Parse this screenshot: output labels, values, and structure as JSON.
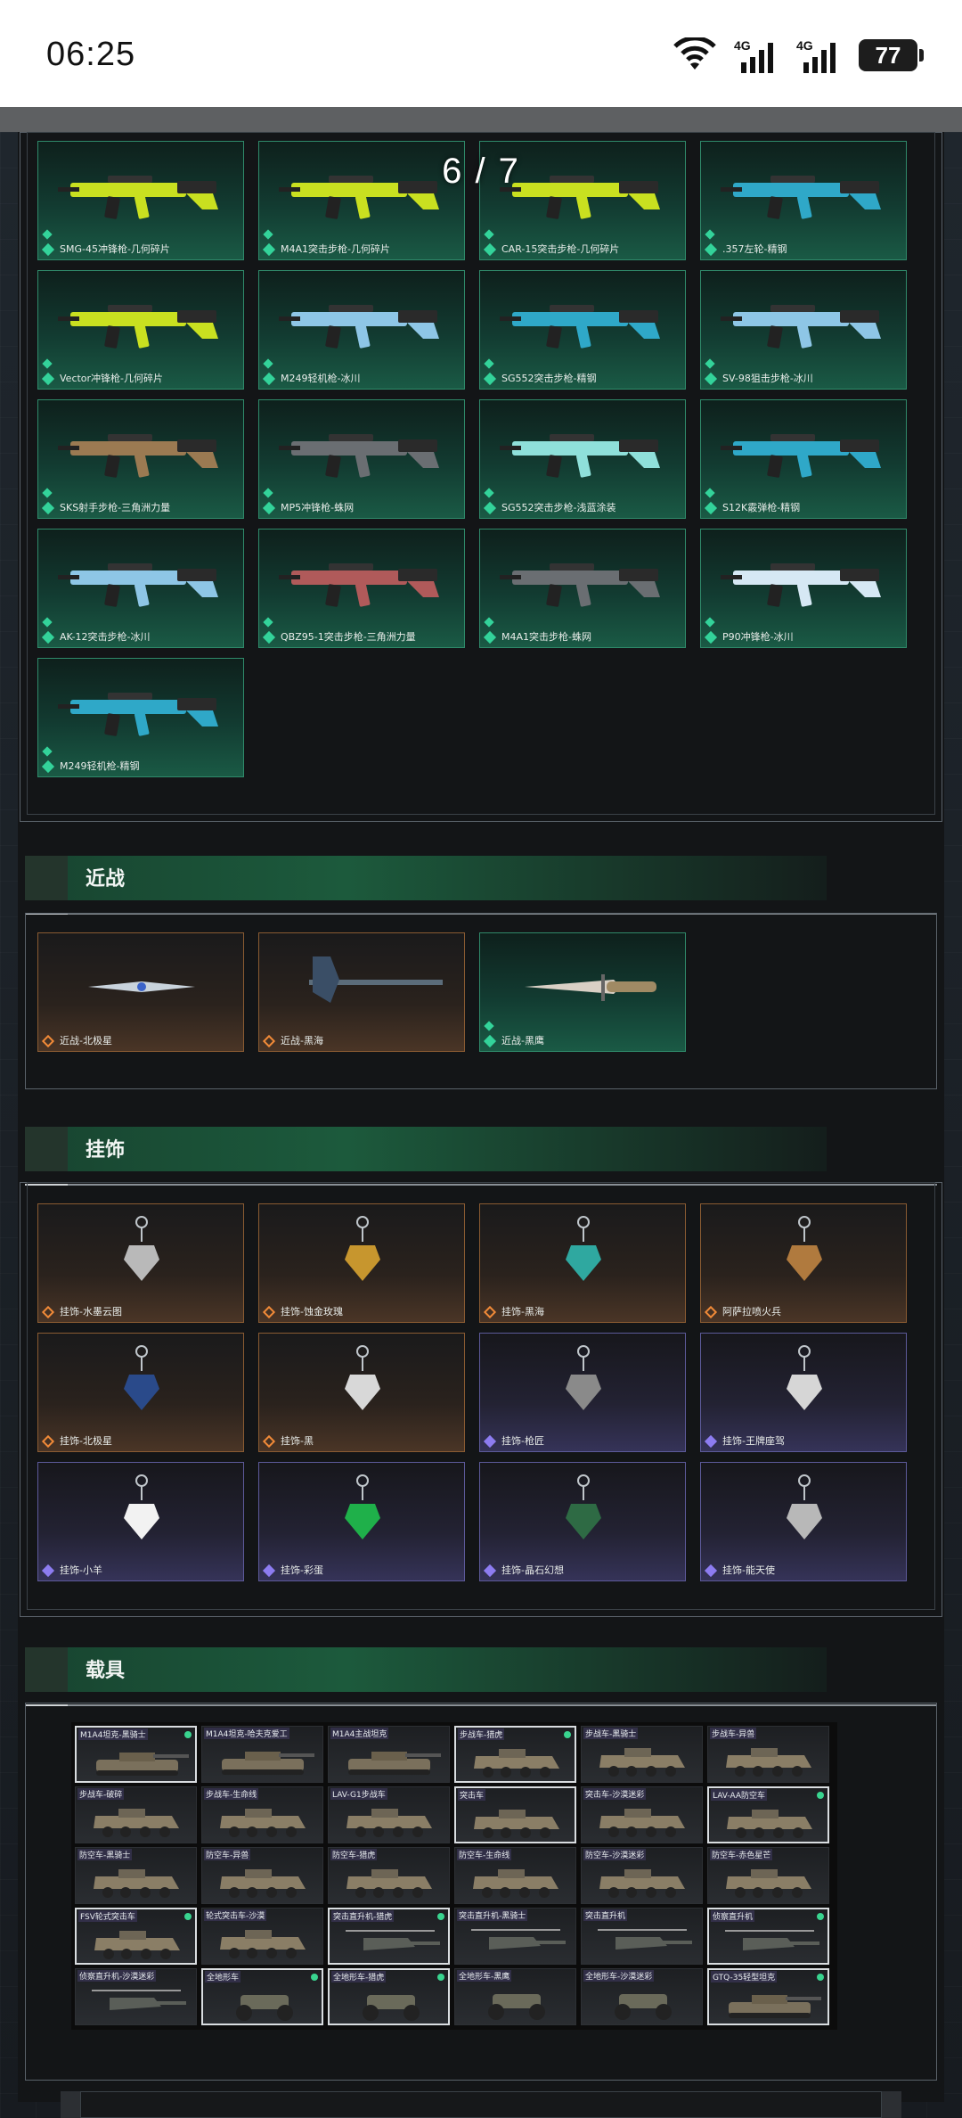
{
  "status_bar": {
    "time": "06:25",
    "network_1": "4G",
    "network_2": "4G",
    "battery": "77"
  },
  "viewer": {
    "counter": "6 / 7"
  },
  "colors": {
    "epic_green": "#33d39a",
    "legend_gold": "#f08a38",
    "rare_purple": "#8d7cf0",
    "header_green": "#1c5a3c"
  },
  "weapons": {
    "items": [
      {
        "label": "SMG-45冲锋枪-几何碎片",
        "rarity": "green",
        "tint": "#c9e020"
      },
      {
        "label": "M4A1突击步枪-几何碎片",
        "rarity": "green",
        "tint": "#c9e020"
      },
      {
        "label": "CAR-15突击步枪-几何碎片",
        "rarity": "green",
        "tint": "#c9e020"
      },
      {
        "label": ".357左轮-精钢",
        "rarity": "green",
        "tint": "#2fa8c8"
      },
      {
        "label": "Vector冲锋枪-几何碎片",
        "rarity": "green",
        "tint": "#c9e020"
      },
      {
        "label": "M249轻机枪-冰川",
        "rarity": "green",
        "tint": "#8ec6e6"
      },
      {
        "label": "SG552突击步枪-精钢",
        "rarity": "green",
        "tint": "#2fa8c8"
      },
      {
        "label": "SV-98狙击步枪-冰川",
        "rarity": "green",
        "tint": "#8ec6e6"
      },
      {
        "label": "SKS射手步枪-三角洲力量",
        "rarity": "green",
        "tint": "#9b7a52"
      },
      {
        "label": "MP5冲锋枪-蛛网",
        "rarity": "green",
        "tint": "#6a6e72"
      },
      {
        "label": "SG552突击步枪-浅蓝涂装",
        "rarity": "green",
        "tint": "#8fe0da"
      },
      {
        "label": "S12K霰弹枪-精钢",
        "rarity": "green",
        "tint": "#2fa8c8"
      },
      {
        "label": "AK-12突击步枪-冰川",
        "rarity": "green",
        "tint": "#8ec6e6"
      },
      {
        "label": "QBZ95-1突击步枪-三角洲力量",
        "rarity": "green",
        "tint": "#b05a5a"
      },
      {
        "label": "M4A1突击步枪-蛛网",
        "rarity": "green",
        "tint": "#6a6e72"
      },
      {
        "label": "P90冲锋枪-冰川",
        "rarity": "green",
        "tint": "#d6e8f4"
      },
      {
        "label": "M249轻机枪-精钢",
        "rarity": "green",
        "tint": "#2fa8c8"
      }
    ]
  },
  "melee": {
    "title": "近战",
    "items": [
      {
        "label": "近战-北极星",
        "rarity": "gold"
      },
      {
        "label": "近战-黑海",
        "rarity": "gold"
      },
      {
        "label": "近战-黑鹰",
        "rarity": "green"
      }
    ]
  },
  "charms": {
    "title": "挂饰",
    "items": [
      {
        "label": "挂饰-水墨云图",
        "rarity": "gold",
        "tint": "#b9b9b9"
      },
      {
        "label": "挂饰-蚀金玫瑰",
        "rarity": "gold",
        "tint": "#c7962e"
      },
      {
        "label": "挂饰-黑海",
        "rarity": "gold",
        "tint": "#2fa8a0"
      },
      {
        "label": "阿萨拉喷火兵",
        "rarity": "gold",
        "tint": "#b07a3e"
      },
      {
        "label": "挂饰-北极星",
        "rarity": "gold",
        "tint": "#2a4a8a"
      },
      {
        "label": "挂饰-黑",
        "rarity": "gold",
        "tint": "#d8d8d8"
      },
      {
        "label": "挂饰-枪匠",
        "rarity": "purple",
        "tint": "#8a8a8a"
      },
      {
        "label": "挂饰-王牌座驾",
        "rarity": "purple",
        "tint": "#d6d6d6"
      },
      {
        "label": "挂饰-小羊",
        "rarity": "purple",
        "tint": "#f2f2f2"
      },
      {
        "label": "挂饰-彩蛋",
        "rarity": "purple",
        "tint": "#1fb04a"
      },
      {
        "label": "挂饰-晶石幻想",
        "rarity": "purple",
        "tint": "#2e6a44"
      },
      {
        "label": "挂饰-能天使",
        "rarity": "purple",
        "tint": "#b8b8b8"
      }
    ]
  },
  "vehicles": {
    "title": "载具",
    "items": [
      {
        "label": "M1A4坦克-黑骑士",
        "dot": true,
        "sel": true,
        "kind": "tank"
      },
      {
        "label": "M1A4坦克-哈夫克爱工",
        "dot": false,
        "sel": false,
        "kind": "tank"
      },
      {
        "label": "M1A4主战坦克",
        "dot": false,
        "sel": false,
        "kind": "tank"
      },
      {
        "label": "步战车-猎虎",
        "dot": true,
        "sel": true,
        "kind": "apc"
      },
      {
        "label": "步战车-黑骑士",
        "dot": false,
        "sel": false,
        "kind": "apc"
      },
      {
        "label": "步战车-异兽",
        "dot": false,
        "sel": false,
        "kind": "apc"
      },
      {
        "label": "步战车-破碎",
        "dot": false,
        "sel": false,
        "kind": "apc"
      },
      {
        "label": "步战车-生命线",
        "dot": false,
        "sel": false,
        "kind": "apc"
      },
      {
        "label": "LAV-G1步战车",
        "dot": false,
        "sel": false,
        "kind": "apc"
      },
      {
        "label": "突击车",
        "dot": false,
        "sel": true,
        "kind": "truck"
      },
      {
        "label": "突击车-沙漠迷彩",
        "dot": false,
        "sel": false,
        "kind": "truck"
      },
      {
        "label": "LAV-AA防空车",
        "dot": true,
        "sel": true,
        "kind": "apc"
      },
      {
        "label": "防空车-黑骑士",
        "dot": false,
        "sel": false,
        "kind": "apc"
      },
      {
        "label": "防空车-异兽",
        "dot": false,
        "sel": false,
        "kind": "apc"
      },
      {
        "label": "防空车-猎虎",
        "dot": false,
        "sel": false,
        "kind": "apc"
      },
      {
        "label": "防空车-生命线",
        "dot": false,
        "sel": false,
        "kind": "apc"
      },
      {
        "label": "防空车-沙漠迷彩",
        "dot": false,
        "sel": false,
        "kind": "apc"
      },
      {
        "label": "防空车-赤色星芒",
        "dot": false,
        "sel": false,
        "kind": "apc"
      },
      {
        "label": "FSV轮式突击车",
        "dot": true,
        "sel": true,
        "kind": "truck"
      },
      {
        "label": "轮式突击车-沙漠",
        "dot": false,
        "sel": false,
        "kind": "truck"
      },
      {
        "label": "突击直升机-猎虎",
        "dot": true,
        "sel": true,
        "kind": "heli"
      },
      {
        "label": "突击直升机-黑骑士",
        "dot": false,
        "sel": false,
        "kind": "heli"
      },
      {
        "label": "突击直升机",
        "dot": false,
        "sel": false,
        "kind": "heli"
      },
      {
        "label": "侦察直升机",
        "dot": true,
        "sel": true,
        "kind": "heli"
      },
      {
        "label": "侦察直升机-沙漠迷彩",
        "dot": false,
        "sel": false,
        "kind": "heli"
      },
      {
        "label": "全地形车",
        "dot": true,
        "sel": true,
        "kind": "atv"
      },
      {
        "label": "全地形车-猎虎",
        "dot": true,
        "sel": true,
        "kind": "atv"
      },
      {
        "label": "全地形车-黑鹰",
        "dot": false,
        "sel": false,
        "kind": "atv"
      },
      {
        "label": "全地形车-沙漠迷彩",
        "dot": false,
        "sel": false,
        "kind": "atv"
      },
      {
        "label": "GTQ-35轻型坦克",
        "dot": true,
        "sel": true,
        "kind": "tank"
      }
    ]
  }
}
